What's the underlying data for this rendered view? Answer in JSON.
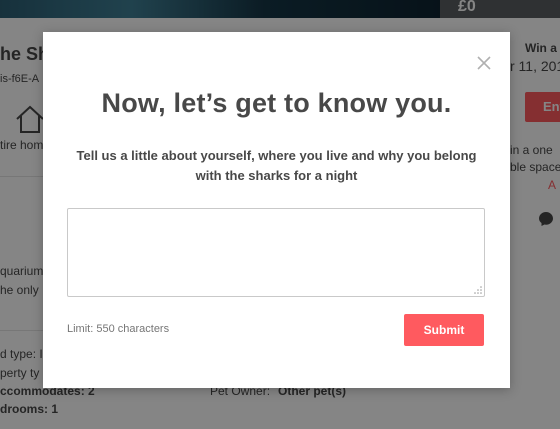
{
  "background": {
    "price_partial": "£0",
    "listing_title_partial": "he Sh",
    "listing_id_partial": "is-f6E-A",
    "home_label_partial": "tire hom",
    "win_label_partial": "Win a",
    "date_partial": "r 11, 201",
    "enter_button_partial": "Ent",
    "win_desc_line1": "in a one",
    "win_desc_line2": "ble space",
    "red_text_partial": "A",
    "aquarium_text_line1": "quarium",
    "aquarium_text_line2": "he only",
    "detail_room_type": "d type: I",
    "detail_property_type": "perty ty",
    "detail_accommodates": "ccommodates: 2",
    "detail_bedrooms": "drooms: 1",
    "pet_owner_label": "Pet Owner:",
    "pet_owner_value": "Other pet(s)"
  },
  "modal": {
    "title": "Now, let’s get to know you.",
    "subtitle": "Tell us a little about yourself, where you live and why you belong with the sharks for a night",
    "textarea_value": "",
    "limit_text": "Limit: 550 characters",
    "submit_label": "Submit",
    "close_icon": "close-icon"
  },
  "colors": {
    "accent": "#ff5a5f",
    "text": "#484848",
    "muted": "#767676",
    "overlay": "rgba(0,0,0,0.48)"
  }
}
